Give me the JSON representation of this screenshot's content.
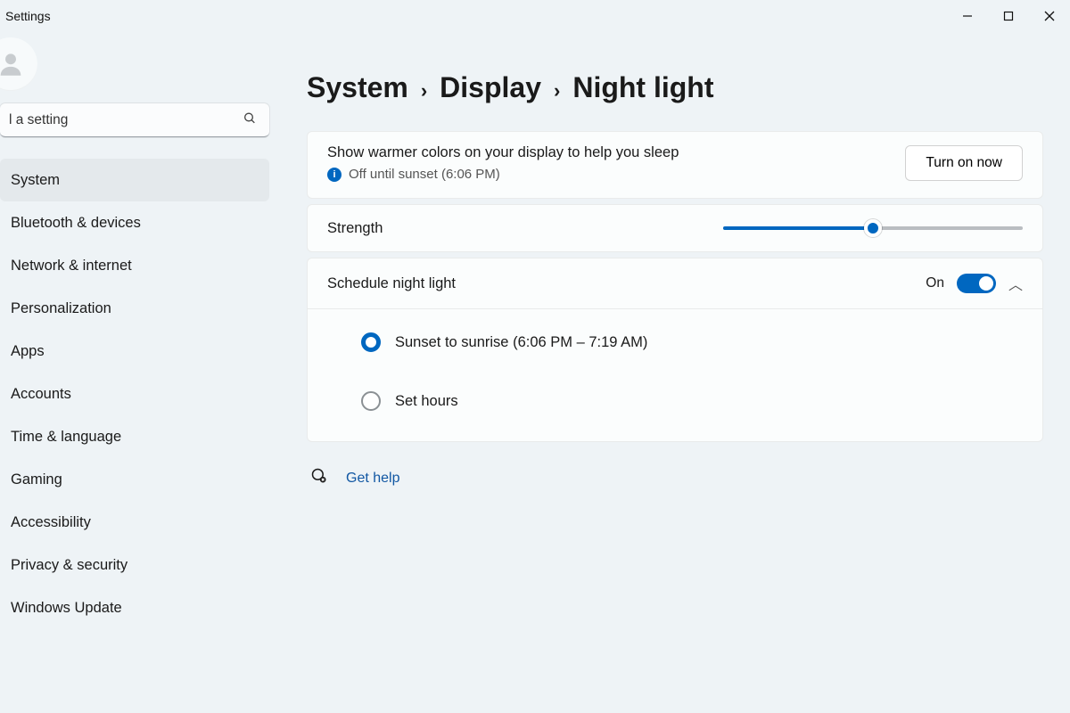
{
  "window": {
    "title": "Settings"
  },
  "search": {
    "placeholder": "Find a setting",
    "displayValue": "l a setting"
  },
  "sidebar": {
    "items": [
      "System",
      "Bluetooth & devices",
      "Network & internet",
      "Personalization",
      "Apps",
      "Accounts",
      "Time & language",
      "Gaming",
      "Accessibility",
      "Privacy & security",
      "Windows Update"
    ],
    "activeIndex": 0
  },
  "breadcrumb": {
    "a": "System",
    "b": "Display",
    "c": "Night light"
  },
  "description": {
    "line1": "Show warmer colors on your display to help you sleep",
    "line2": "Off until sunset (6:06 PM)",
    "button": "Turn on now"
  },
  "strength": {
    "label": "Strength",
    "percent": 50
  },
  "schedule": {
    "label": "Schedule night light",
    "toggleText": "On",
    "toggleOn": true,
    "option1": "Sunset to sunrise (6:06 PM – 7:19 AM)",
    "option2": "Set hours",
    "selected": 1
  },
  "help": {
    "label": "Get help"
  }
}
